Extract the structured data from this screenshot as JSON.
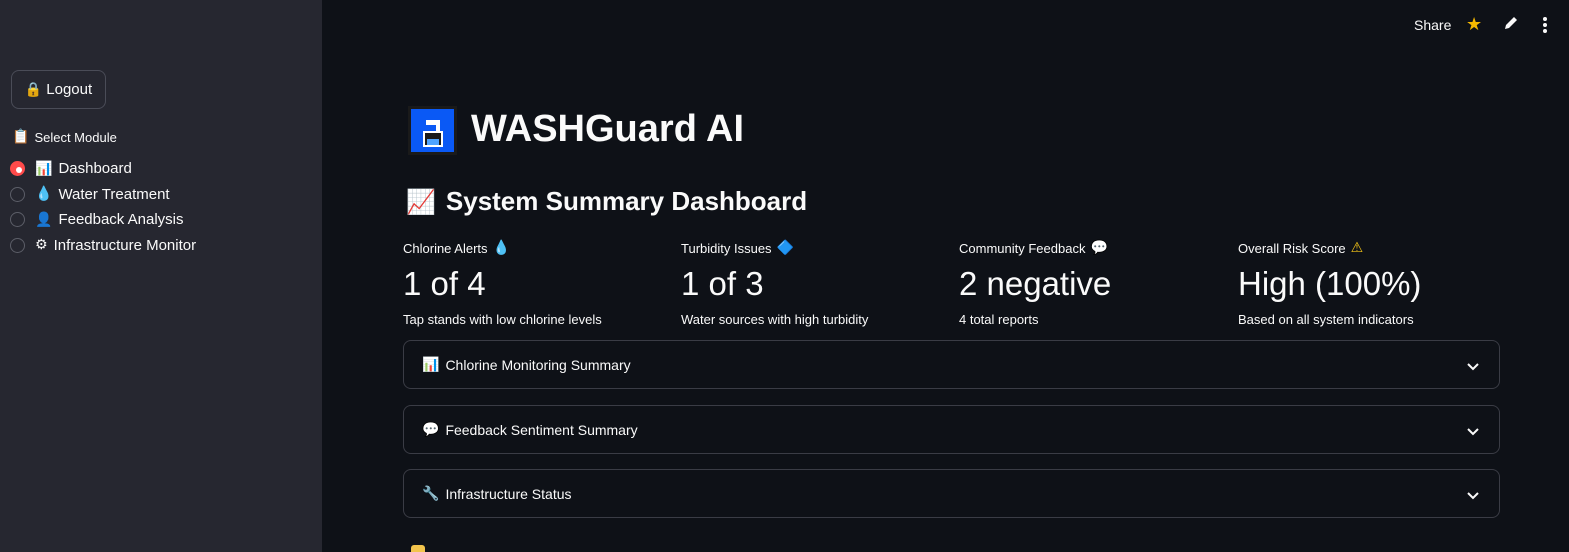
{
  "sidebar": {
    "logout_label": "Logout",
    "logout_icon": "🔒",
    "module_label": "Select Module",
    "module_icon": "📋",
    "items": [
      {
        "icon": "📊",
        "label": "Dashboard",
        "selected": true
      },
      {
        "icon": "💧",
        "label": "Water Treatment",
        "selected": false
      },
      {
        "icon": "👤",
        "label": "Feedback Analysis",
        "selected": false
      },
      {
        "icon": "⚙",
        "label": "Infrastructure Monitor",
        "selected": false
      }
    ]
  },
  "toolbar": {
    "share_label": "Share",
    "star_icon": "★"
  },
  "header": {
    "title": "WASHGuard AI",
    "logo_icon": "water-tap-icon"
  },
  "section": {
    "title": "System Summary Dashboard",
    "icon": "📈"
  },
  "metrics": [
    {
      "label": "Chlorine Alerts",
      "icon": "💧",
      "value": "1 of 4",
      "delta": "Tap stands with low chlorine levels"
    },
    {
      "label": "Turbidity Issues",
      "icon": "🔷",
      "value": "1 of 3",
      "delta": "Water sources with high turbidity"
    },
    {
      "label": "Community Feedback",
      "icon": "💬",
      "value": "2 negative",
      "delta": "4 total reports"
    },
    {
      "label": "Overall Risk Score",
      "icon": "⚠",
      "value": "High (100%)",
      "delta": "Based on all system indicators"
    }
  ],
  "expanders": [
    {
      "icon": "📊",
      "label": "Chlorine Monitoring Summary"
    },
    {
      "icon": "💬",
      "label": "Feedback Sentiment Summary"
    },
    {
      "icon": "🔧",
      "label": "Infrastructure Status"
    }
  ],
  "colors": {
    "accent": "#ff4b4b",
    "background": "#0e1117",
    "sidebar": "#262730",
    "logo": "#0a59f5",
    "star": "#f5b800"
  }
}
